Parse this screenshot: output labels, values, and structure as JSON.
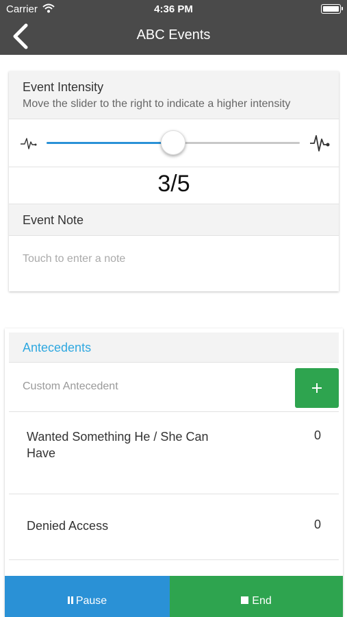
{
  "status_bar": {
    "carrier": "Carrier",
    "time": "4:36 PM"
  },
  "nav": {
    "title": "ABC Events",
    "back_icon": "chevron-left-icon"
  },
  "intensity": {
    "title": "Event Intensity",
    "subtitle": "Move the slider to the right to indicate a higher intensity",
    "slider_value": 3,
    "slider_max": 5,
    "value_text": "3/5",
    "left_icon": "pulse-low-icon",
    "right_icon": "pulse-high-icon",
    "accent_color": "#2a91d6"
  },
  "note": {
    "title": "Event Note",
    "placeholder": "Touch to enter a note"
  },
  "antecedents": {
    "title": "Antecedents",
    "custom_placeholder": "Custom Antecedent",
    "add_icon": "plus-icon",
    "items": [
      {
        "label": "Wanted Something He / She Can Have",
        "count": "0"
      },
      {
        "label": "Denied Access",
        "count": "0"
      }
    ]
  },
  "footer": {
    "pause_label": "Pause",
    "end_label": "End"
  },
  "colors": {
    "nav_bg": "#4a4a4a",
    "pause": "#2a91d6",
    "end": "#2ea44f",
    "link": "#2fa8e0"
  }
}
